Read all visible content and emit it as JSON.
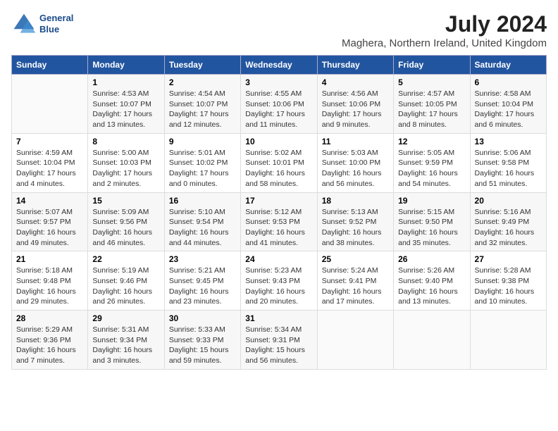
{
  "header": {
    "logo_line1": "General",
    "logo_line2": "Blue",
    "month_year": "July 2024",
    "location": "Maghera, Northern Ireland, United Kingdom"
  },
  "columns": [
    "Sunday",
    "Monday",
    "Tuesday",
    "Wednesday",
    "Thursday",
    "Friday",
    "Saturday"
  ],
  "weeks": [
    [
      {
        "day": "",
        "content": ""
      },
      {
        "day": "1",
        "content": "Sunrise: 4:53 AM\nSunset: 10:07 PM\nDaylight: 17 hours\nand 13 minutes."
      },
      {
        "day": "2",
        "content": "Sunrise: 4:54 AM\nSunset: 10:07 PM\nDaylight: 17 hours\nand 12 minutes."
      },
      {
        "day": "3",
        "content": "Sunrise: 4:55 AM\nSunset: 10:06 PM\nDaylight: 17 hours\nand 11 minutes."
      },
      {
        "day": "4",
        "content": "Sunrise: 4:56 AM\nSunset: 10:06 PM\nDaylight: 17 hours\nand 9 minutes."
      },
      {
        "day": "5",
        "content": "Sunrise: 4:57 AM\nSunset: 10:05 PM\nDaylight: 17 hours\nand 8 minutes."
      },
      {
        "day": "6",
        "content": "Sunrise: 4:58 AM\nSunset: 10:04 PM\nDaylight: 17 hours\nand 6 minutes."
      }
    ],
    [
      {
        "day": "7",
        "content": "Sunrise: 4:59 AM\nSunset: 10:04 PM\nDaylight: 17 hours\nand 4 minutes."
      },
      {
        "day": "8",
        "content": "Sunrise: 5:00 AM\nSunset: 10:03 PM\nDaylight: 17 hours\nand 2 minutes."
      },
      {
        "day": "9",
        "content": "Sunrise: 5:01 AM\nSunset: 10:02 PM\nDaylight: 17 hours\nand 0 minutes."
      },
      {
        "day": "10",
        "content": "Sunrise: 5:02 AM\nSunset: 10:01 PM\nDaylight: 16 hours\nand 58 minutes."
      },
      {
        "day": "11",
        "content": "Sunrise: 5:03 AM\nSunset: 10:00 PM\nDaylight: 16 hours\nand 56 minutes."
      },
      {
        "day": "12",
        "content": "Sunrise: 5:05 AM\nSunset: 9:59 PM\nDaylight: 16 hours\nand 54 minutes."
      },
      {
        "day": "13",
        "content": "Sunrise: 5:06 AM\nSunset: 9:58 PM\nDaylight: 16 hours\nand 51 minutes."
      }
    ],
    [
      {
        "day": "14",
        "content": "Sunrise: 5:07 AM\nSunset: 9:57 PM\nDaylight: 16 hours\nand 49 minutes."
      },
      {
        "day": "15",
        "content": "Sunrise: 5:09 AM\nSunset: 9:56 PM\nDaylight: 16 hours\nand 46 minutes."
      },
      {
        "day": "16",
        "content": "Sunrise: 5:10 AM\nSunset: 9:54 PM\nDaylight: 16 hours\nand 44 minutes."
      },
      {
        "day": "17",
        "content": "Sunrise: 5:12 AM\nSunset: 9:53 PM\nDaylight: 16 hours\nand 41 minutes."
      },
      {
        "day": "18",
        "content": "Sunrise: 5:13 AM\nSunset: 9:52 PM\nDaylight: 16 hours\nand 38 minutes."
      },
      {
        "day": "19",
        "content": "Sunrise: 5:15 AM\nSunset: 9:50 PM\nDaylight: 16 hours\nand 35 minutes."
      },
      {
        "day": "20",
        "content": "Sunrise: 5:16 AM\nSunset: 9:49 PM\nDaylight: 16 hours\nand 32 minutes."
      }
    ],
    [
      {
        "day": "21",
        "content": "Sunrise: 5:18 AM\nSunset: 9:48 PM\nDaylight: 16 hours\nand 29 minutes."
      },
      {
        "day": "22",
        "content": "Sunrise: 5:19 AM\nSunset: 9:46 PM\nDaylight: 16 hours\nand 26 minutes."
      },
      {
        "day": "23",
        "content": "Sunrise: 5:21 AM\nSunset: 9:45 PM\nDaylight: 16 hours\nand 23 minutes."
      },
      {
        "day": "24",
        "content": "Sunrise: 5:23 AM\nSunset: 9:43 PM\nDaylight: 16 hours\nand 20 minutes."
      },
      {
        "day": "25",
        "content": "Sunrise: 5:24 AM\nSunset: 9:41 PM\nDaylight: 16 hours\nand 17 minutes."
      },
      {
        "day": "26",
        "content": "Sunrise: 5:26 AM\nSunset: 9:40 PM\nDaylight: 16 hours\nand 13 minutes."
      },
      {
        "day": "27",
        "content": "Sunrise: 5:28 AM\nSunset: 9:38 PM\nDaylight: 16 hours\nand 10 minutes."
      }
    ],
    [
      {
        "day": "28",
        "content": "Sunrise: 5:29 AM\nSunset: 9:36 PM\nDaylight: 16 hours\nand 7 minutes."
      },
      {
        "day": "29",
        "content": "Sunrise: 5:31 AM\nSunset: 9:34 PM\nDaylight: 16 hours\nand 3 minutes."
      },
      {
        "day": "30",
        "content": "Sunrise: 5:33 AM\nSunset: 9:33 PM\nDaylight: 15 hours\nand 59 minutes."
      },
      {
        "day": "31",
        "content": "Sunrise: 5:34 AM\nSunset: 9:31 PM\nDaylight: 15 hours\nand 56 minutes."
      },
      {
        "day": "",
        "content": ""
      },
      {
        "day": "",
        "content": ""
      },
      {
        "day": "",
        "content": ""
      }
    ]
  ]
}
